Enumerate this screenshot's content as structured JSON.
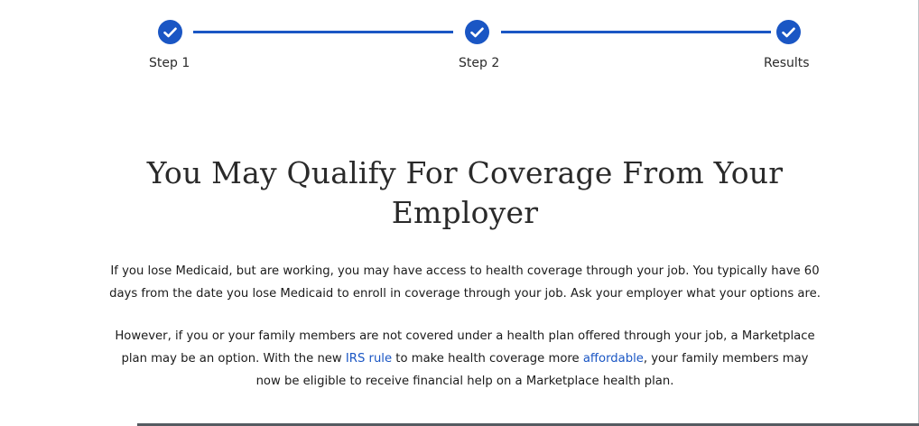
{
  "stepper": {
    "steps": [
      {
        "label": "Step 1",
        "status": "complete",
        "icon": "check-icon"
      },
      {
        "label": "Step 2",
        "status": "complete",
        "icon": "check-icon"
      },
      {
        "label": "Results",
        "status": "complete",
        "icon": "check-icon"
      }
    ],
    "accent_color": "#1a56c4"
  },
  "main": {
    "title": "You May Qualify For Coverage From Your Employer",
    "paragraph1": "If you lose Medicaid, but are working, you may have access to health coverage through your job. You typically have 60 days from the date you lose Medicaid to enroll in coverage through your job. Ask your employer what your options are.",
    "paragraph2": {
      "text_before": "However, if you or your family members are not covered under a health plan offered through your job, a Marketplace plan may be an option. With the new ",
      "link1": "IRS rule",
      "text_middle": " to make health coverage more ",
      "link2": "affordable",
      "text_after": ", your family members may now be eligible to receive financial help on a Marketplace health plan."
    }
  }
}
